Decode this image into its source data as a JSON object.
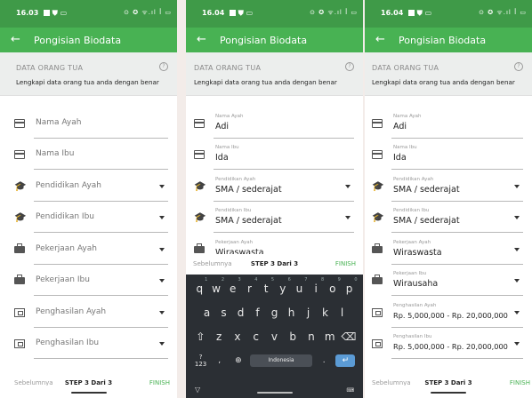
{
  "app": {
    "title": "Pongisian Biodata",
    "section_title": "DATA ORANG TUA",
    "section_subtitle": "Lengkapi data orang tua anda dengan benar"
  },
  "status": {
    "screen1_time": "16.03",
    "screen2_time": "16.04",
    "screen3_time": "16.04",
    "icons": "⊙ ✪ ᯤ.ıl ꟾ ▭"
  },
  "labels": {
    "nama_ayah": "Nama Ayah",
    "nama_ibu": "Nama Ibu",
    "pendidikan_ayah": "Pendidikan Ayah",
    "pendidikan_ibu": "Pendidikan Ibu",
    "pekerjaan_ayah": "Pekerjaan Ayah",
    "pekerjaan_ibu": "Pekerjaan Ibu",
    "penghasilan_ayah": "Penghasilan Ayah",
    "penghasilan_ibu": "Penghasilan Ibu"
  },
  "values": {
    "nama_ayah": "Adi",
    "nama_ibu": "Ida",
    "pendidikan_ayah": "SMA / sederajat",
    "pendidikan_ibu": "SMA / sederajat",
    "pekerjaan_ayah": "Wiraswasta",
    "pekerjaan_ibu": "Wirausaha",
    "penghasilan_ayah": "Rp. 5,000,000 - Rp. 20,000,000",
    "penghasilan_ibu": "Rp. 5,000,000 - Rp. 20,000,000"
  },
  "footer": {
    "prev": "Sebelumnya",
    "step": "STEP 3 Dari 3",
    "finish": "FINISH"
  },
  "keyboard": {
    "row1": [
      "q",
      "w",
      "e",
      "r",
      "t",
      "y",
      "u",
      "i",
      "o",
      "p"
    ],
    "row1_sup": [
      "1",
      "2",
      "3",
      "4",
      "5",
      "6",
      "7",
      "8",
      "9",
      "0"
    ],
    "row2": [
      "a",
      "s",
      "d",
      "f",
      "g",
      "h",
      "j",
      "k",
      "l"
    ],
    "row3": [
      "⇧",
      "z",
      "x",
      "c",
      "v",
      "b",
      "n",
      "m",
      "⌫"
    ],
    "num_key": "?123",
    "comma": ",",
    "globe": "⊕",
    "space_label": "Indonesia",
    "period": ".",
    "enter": "↵",
    "nav_down": "▽",
    "nav_kb": "⌨"
  },
  "colors": {
    "primary": "#48b253",
    "primary_dark": "#3f9a48",
    "accent_finish": "#48b253"
  }
}
